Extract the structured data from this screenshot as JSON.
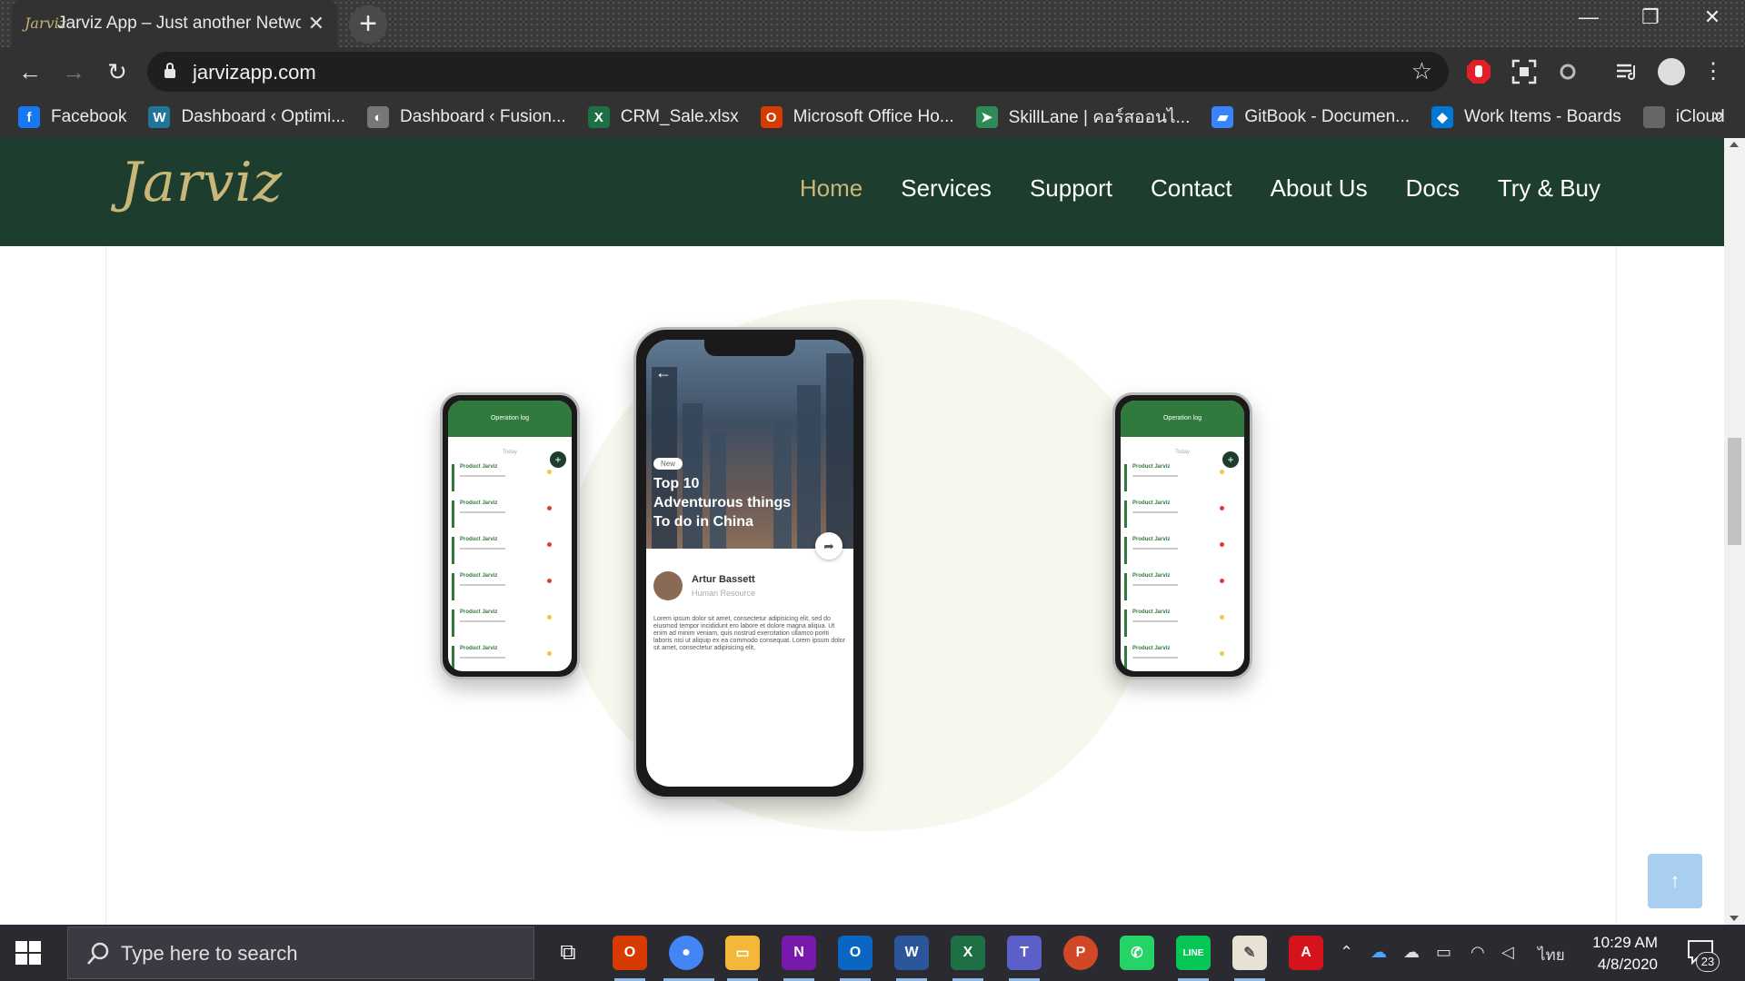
{
  "browser": {
    "tab_title": "Jarviz App – Just another Networ",
    "tab_favicon": "Jarviz",
    "url": "jarvizapp.com",
    "bookmarks": [
      {
        "label": "Facebook",
        "icon": "facebook-icon",
        "color": "#1877f2",
        "glyph": "f"
      },
      {
        "label": "Dashboard ‹ Optimi...",
        "icon": "wordpress-icon",
        "color": "#21759b",
        "glyph": "W"
      },
      {
        "label": "Dashboard ‹ Fusion...",
        "icon": "globe-icon",
        "color": "#777777",
        "glyph": "◐"
      },
      {
        "label": "CRM_Sale.xlsx",
        "icon": "excel-icon",
        "color": "#1d7044",
        "glyph": "X"
      },
      {
        "label": "Microsoft Office Ho...",
        "icon": "office-icon",
        "color": "#d83b01",
        "glyph": "O"
      },
      {
        "label": "SkillLane | คอร์สออนไ...",
        "icon": "skilllane-icon",
        "color": "#2e8b57",
        "glyph": "➤"
      },
      {
        "label": "GitBook - Documen...",
        "icon": "gitbook-icon",
        "color": "#3884ff",
        "glyph": "▰"
      },
      {
        "label": "Work Items - Boards",
        "icon": "azure-boards-icon",
        "color": "#0078d4",
        "glyph": "◆"
      },
      {
        "label": "iCloud",
        "icon": "apple-icon",
        "color": "#666666",
        "glyph": ""
      }
    ],
    "bookmarks_more": "»"
  },
  "site": {
    "logo": "Jarviz",
    "nav": [
      {
        "label": "Home",
        "active": true
      },
      {
        "label": "Services",
        "active": false
      },
      {
        "label": "Support",
        "active": false
      },
      {
        "label": "Contact",
        "active": false
      },
      {
        "label": "About Us",
        "active": false
      },
      {
        "label": "Docs",
        "active": false
      },
      {
        "label": "Try & Buy",
        "active": false
      }
    ],
    "colors": {
      "header_bg": "#1d3d2f",
      "accent_gold": "#c9b779",
      "app_green": "#2f7a3c"
    }
  },
  "phone_small": {
    "header": "Operation log",
    "today": "Today",
    "rows": [
      {
        "title": "Product Jarviz",
        "status_color": "#f5c542"
      },
      {
        "title": "Product Jarviz",
        "status_color": "#e53935"
      },
      {
        "title": "Product Jarviz",
        "status_color": "#e53935"
      },
      {
        "title": "Product Jarviz",
        "status_color": "#e53935"
      },
      {
        "title": "Product Jarviz",
        "status_color": "#f5c542"
      },
      {
        "title": "Product Jarviz",
        "status_color": "#f5c542"
      }
    ]
  },
  "phone_big": {
    "badge": "New",
    "title": "Top 10\nAdventurous things\nTo do in China",
    "author": "Artur Bassett",
    "role": "Human Resource",
    "body": "Lorem ipsum dolor sit amet, consectetur adipisicing elit, sed do eiusmod tempor incididunt ero labore et dolore magna aliqua. Ut enim ad minim veniam, quis nostrud exercitation ullamco poriti laboris nisi ut aliquip ex ea commodo consequat. Lorem ipsum dolor sit amet, consectetur adipisicing elit,"
  },
  "taskbar": {
    "search_placeholder": "Type here to search",
    "time": "10:29 AM",
    "date": "4/8/2020",
    "language": "ไทย",
    "notification_count": "23"
  }
}
